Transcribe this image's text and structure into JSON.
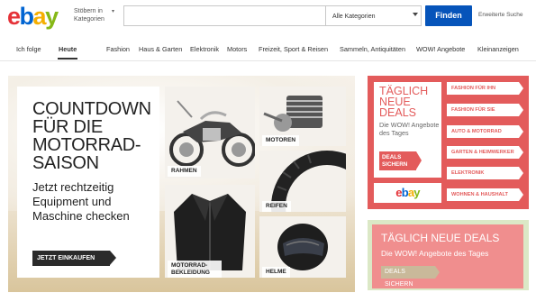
{
  "header": {
    "logo_letters": [
      {
        "ch": "e",
        "color": "#e53238"
      },
      {
        "ch": "b",
        "color": "#0064d2"
      },
      {
        "ch": "a",
        "color": "#f5af02"
      },
      {
        "ch": "y",
        "color": "#86b817"
      }
    ],
    "browse_label": "Stöbern in Kategorien",
    "search_value": "",
    "category_select": "Alle Kategorien",
    "search_button": "Finden",
    "advanced_search": "Erweiterte Suche"
  },
  "nav": {
    "items": [
      "Ich folge",
      "Heute",
      "Fashion",
      "Haus & Garten",
      "Elektronik",
      "Motors",
      "Freizeit, Sport & Reisen",
      "Sammeln, Antiquitäten",
      "WOW! Angebote",
      "Kleinanzeigen"
    ],
    "active": "Heute"
  },
  "banner": {
    "headline": "COUNTDOWN FÜR DIE MOTORRAD-SAISON",
    "subline": "Jetzt rechtzeitig Equipment und Maschine checken",
    "cta": "JETZT EINKAUFEN",
    "tiles": {
      "rahmen": "RAHMEN",
      "motoren": "MOTOREN",
      "reifen": "REIFEN",
      "bekleidung": "MOTORRAD-BEKLEIDUNG",
      "helme": "HELME"
    }
  },
  "deals": {
    "title": "TÄGLICH NEUE DEALS",
    "subtitle": "Die WOW! Angebote des Tages",
    "cta": "DEALS SICHERN",
    "logo_text": "ebay",
    "categories": [
      "FASHION FÜR IHN",
      "FASHION FÜR SIE",
      "AUTO & MOTORRAD",
      "GARTEN & HEIMWERKER",
      "ELEKTRONIK",
      "WOHNEN & HAUSHALT"
    ],
    "accent": "#e35b5b"
  },
  "deals_secondary": {
    "title": "TÄGLICH NEUE DEALS",
    "subtitle": "Die WOW! Angebote des Tages",
    "cta": "DEALS SICHERN"
  }
}
